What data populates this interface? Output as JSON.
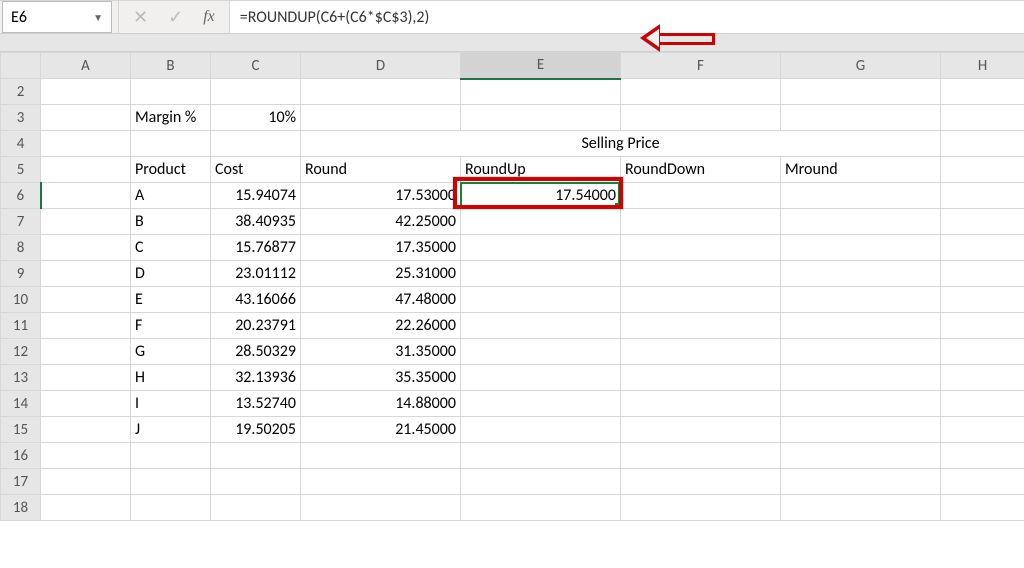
{
  "namebox": {
    "value": "E6"
  },
  "formula": {
    "value": "=ROUNDUP(C6+(C6*$C$3),2)"
  },
  "colHeaders": [
    "A",
    "B",
    "C",
    "D",
    "E",
    "F",
    "G",
    "H"
  ],
  "rowHeaders": [
    "2",
    "3",
    "4",
    "5",
    "6",
    "7",
    "8",
    "9",
    "10",
    "11",
    "12",
    "13",
    "14",
    "15",
    "16",
    "17",
    "18"
  ],
  "activeCol": "E",
  "activeRow": "6",
  "labels": {
    "marginLabel": "Margin %",
    "marginValue": "10%",
    "productHdr": "Product",
    "costHdr": "Cost",
    "sellingPrice": "Selling Price",
    "roundHdr": "Round",
    "roundUpHdr": "RoundUp",
    "roundDownHdr": "RoundDown",
    "mroundHdr": "Mround"
  },
  "rows": [
    {
      "product": "A",
      "cost": "15.94074",
      "round": "17.53000",
      "roundup": "17.54000"
    },
    {
      "product": "B",
      "cost": "38.40935",
      "round": "42.25000",
      "roundup": ""
    },
    {
      "product": "C",
      "cost": "15.76877",
      "round": "17.35000",
      "roundup": ""
    },
    {
      "product": "D",
      "cost": "23.01112",
      "round": "25.31000",
      "roundup": ""
    },
    {
      "product": "E",
      "cost": "43.16066",
      "round": "47.48000",
      "roundup": ""
    },
    {
      "product": "F",
      "cost": "20.23791",
      "round": "22.26000",
      "roundup": ""
    },
    {
      "product": "G",
      "cost": "28.50329",
      "round": "31.35000",
      "roundup": ""
    },
    {
      "product": "H",
      "cost": "32.13936",
      "round": "35.35000",
      "roundup": ""
    },
    {
      "product": "I",
      "cost": "13.52740",
      "round": "14.88000",
      "roundup": ""
    },
    {
      "product": "J",
      "cost": "19.50205",
      "round": "21.45000",
      "roundup": ""
    }
  ],
  "chart_data": {
    "type": "table",
    "title": "Selling Price rounding comparison",
    "margin_percent": 10,
    "columns": [
      "Product",
      "Cost",
      "Round",
      "RoundUp",
      "RoundDown",
      "Mround"
    ],
    "data": [
      {
        "Product": "A",
        "Cost": 15.94074,
        "Round": 17.53,
        "RoundUp": 17.54,
        "RoundDown": null,
        "Mround": null
      },
      {
        "Product": "B",
        "Cost": 38.40935,
        "Round": 42.25,
        "RoundUp": null,
        "RoundDown": null,
        "Mround": null
      },
      {
        "Product": "C",
        "Cost": 15.76877,
        "Round": 17.35,
        "RoundUp": null,
        "RoundDown": null,
        "Mround": null
      },
      {
        "Product": "D",
        "Cost": 23.01112,
        "Round": 25.31,
        "RoundUp": null,
        "RoundDown": null,
        "Mround": null
      },
      {
        "Product": "E",
        "Cost": 43.16066,
        "Round": 47.48,
        "RoundUp": null,
        "RoundDown": null,
        "Mround": null
      },
      {
        "Product": "F",
        "Cost": 20.23791,
        "Round": 22.26,
        "RoundUp": null,
        "RoundDown": null,
        "Mround": null
      },
      {
        "Product": "G",
        "Cost": 28.50329,
        "Round": 31.35,
        "RoundUp": null,
        "RoundDown": null,
        "Mround": null
      },
      {
        "Product": "H",
        "Cost": 32.13936,
        "Round": 35.35,
        "RoundUp": null,
        "RoundDown": null,
        "Mround": null
      },
      {
        "Product": "I",
        "Cost": 13.5274,
        "Round": 14.88,
        "RoundUp": null,
        "RoundDown": null,
        "Mround": null
      },
      {
        "Product": "J",
        "Cost": 19.50205,
        "Round": 21.45,
        "RoundUp": null,
        "RoundDown": null,
        "Mround": null
      }
    ]
  }
}
